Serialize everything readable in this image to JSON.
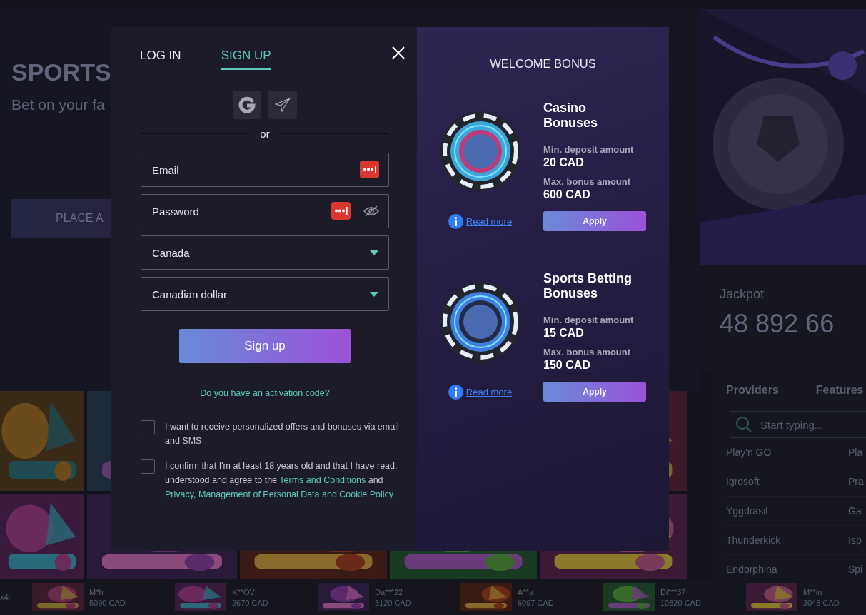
{
  "background": {
    "hero": {
      "title": "SPORTS",
      "subtitle": "Bet on your fa",
      "button": "PLACE A"
    },
    "jackpot": {
      "label": "Jackpot",
      "amount": "48 892 66"
    },
    "providers": {
      "tabs": [
        {
          "label": "Providers"
        },
        {
          "label": "Features"
        }
      ],
      "search": {
        "placeholder": "Start typing..."
      },
      "rows": [
        [
          "Play'n GO",
          "Pla"
        ],
        [
          "Igrosoft",
          "Pra"
        ],
        [
          "Yggdrasil",
          "Ga"
        ],
        [
          "Thunderkick",
          "Isp"
        ],
        [
          "Endorphina",
          "Spi"
        ]
      ]
    },
    "winners": [
      {
        "name": "x4r"
      },
      {
        "name": "M*h",
        "amount": "5090 CAD"
      },
      {
        "name": "K**OV",
        "amount": "2670 CAD"
      },
      {
        "name": "Da***22",
        "amount": "3120 CAD"
      },
      {
        "name": "A**a",
        "amount": "6097 CAD"
      },
      {
        "name": "Di***37",
        "amount": "10820 CAD"
      },
      {
        "name": "M**in",
        "amount": "3045 CAD"
      }
    ]
  },
  "modal": {
    "tabs": [
      {
        "label": "LOG IN",
        "selected": false
      },
      {
        "label": "SIGN UP",
        "selected": true
      }
    ],
    "divider": "or",
    "fields": [
      {
        "kind": "email",
        "placeholder": "Email"
      },
      {
        "kind": "password",
        "placeholder": "Password"
      },
      {
        "kind": "select",
        "value": "Canada"
      },
      {
        "kind": "select",
        "value": "Canadian dollar"
      }
    ],
    "submit": "Sign up",
    "activation_link": "Do you have an activation code?",
    "checkboxes": [
      {
        "checked": false,
        "parts": [
          {
            "kind": "text",
            "text": "I want to receive personalized offers and bonuses via email and SMS"
          }
        ]
      },
      {
        "checked": false,
        "parts": [
          {
            "kind": "text",
            "text": "I confirm that I'm at least 18 years old and that I have read, understood and agree to the "
          },
          {
            "kind": "link",
            "text": "Terms and Conditions"
          },
          {
            "kind": "text",
            "text": " and "
          },
          {
            "kind": "link",
            "text": "Privacy, Management of Personal Data and Cookie Policy"
          }
        ]
      }
    ],
    "bonus_title": "WELCOME BONUS",
    "bonuses": [
      {
        "title": "Casino Bonuses",
        "min_label": "Min. deposit amount",
        "min_value": "20 CAD",
        "max_label": "Max. bonus amount",
        "max_value": "600 CAD",
        "read_more": "Read more",
        "apply": "Apply"
      },
      {
        "title": "Sports Betting Bonuses",
        "min_label": "Min. deposit amount",
        "min_value": "15 CAD",
        "max_label": "Max. bonus amount",
        "max_value": "150 CAD",
        "read_more": "Read more",
        "apply": "Apply"
      }
    ]
  }
}
